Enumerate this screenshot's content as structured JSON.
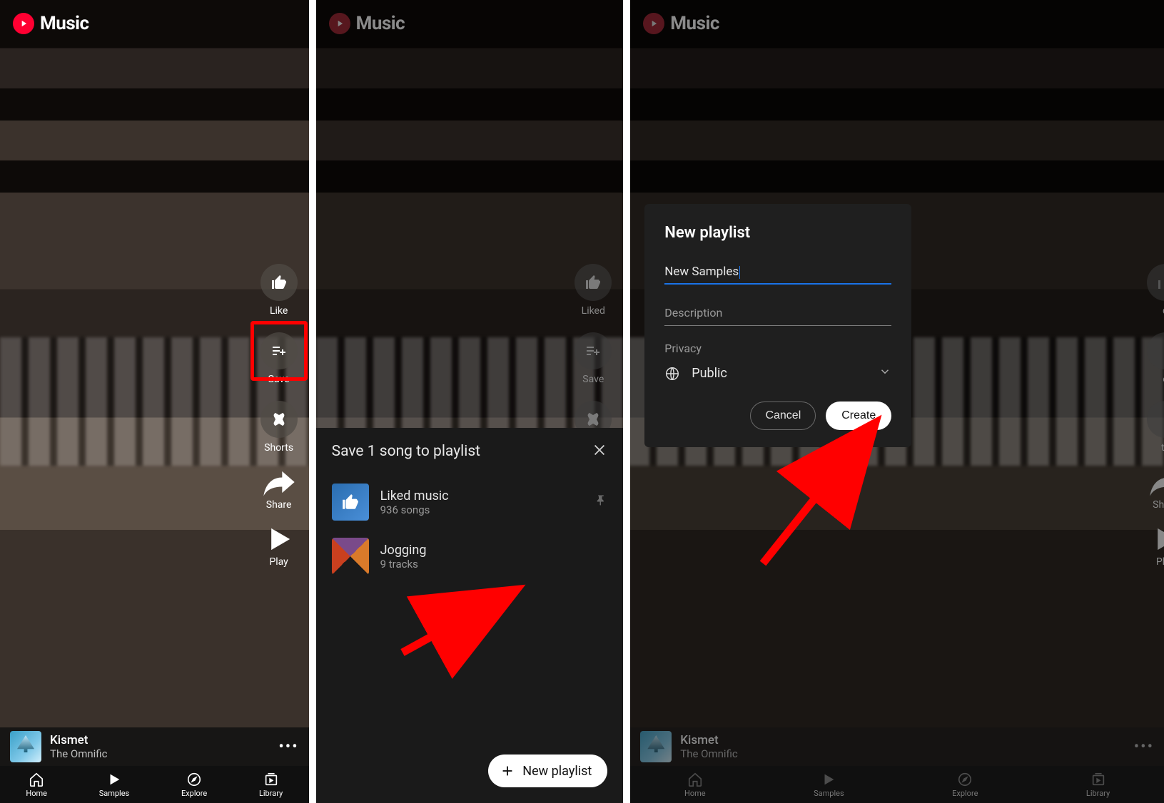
{
  "app": {
    "title": "Music"
  },
  "actions": {
    "like": "Like",
    "liked": "Liked",
    "save": "Save",
    "shorts": "Shorts",
    "share": "Share",
    "play": "Play"
  },
  "now_playing": {
    "title": "Kismet",
    "artist": "The Omnific"
  },
  "nav": {
    "home": "Home",
    "samples": "Samples",
    "explore": "Explore",
    "library": "Library"
  },
  "save_sheet": {
    "title": "Save 1 song to playlist",
    "playlists": [
      {
        "name": "Liked music",
        "meta": "936 songs",
        "type": "liked"
      },
      {
        "name": "Jogging",
        "meta": "9 tracks",
        "type": "jogging"
      }
    ],
    "new_playlist": "New playlist"
  },
  "dialog": {
    "title": "New playlist",
    "name_value": "New Samples",
    "description_label": "Description",
    "privacy_label": "Privacy",
    "privacy_value": "Public",
    "cancel": "Cancel",
    "create": "Create"
  }
}
